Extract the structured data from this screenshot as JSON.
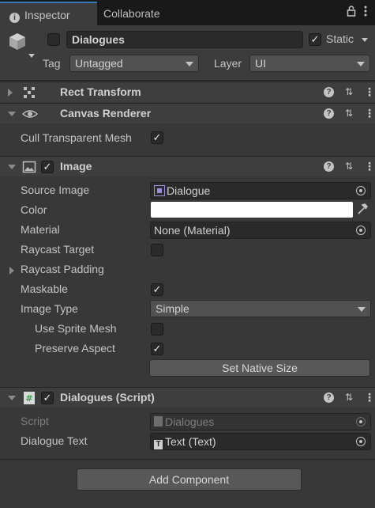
{
  "tabs": {
    "inspector": "Inspector",
    "collaborate": "Collaborate"
  },
  "header": {
    "active": true,
    "name": "Dialogues",
    "static_label": "Static",
    "static_checked": true,
    "tag_label": "Tag",
    "tag_value": "Untagged",
    "layer_label": "Layer",
    "layer_value": "UI"
  },
  "rect_transform": {
    "title": "Rect Transform"
  },
  "canvas_renderer": {
    "title": "Canvas Renderer",
    "cull_label": "Cull Transparent Mesh",
    "cull_checked": true
  },
  "image": {
    "title": "Image",
    "enabled": true,
    "source_image_label": "Source Image",
    "source_image_value": "Dialogue",
    "color_label": "Color",
    "color_value": "#ffffff",
    "material_label": "Material",
    "material_value": "None (Material)",
    "raycast_target_label": "Raycast Target",
    "raycast_target_checked": false,
    "raycast_padding_label": "Raycast Padding",
    "maskable_label": "Maskable",
    "maskable_checked": true,
    "image_type_label": "Image Type",
    "image_type_value": "Simple",
    "use_sprite_mesh_label": "Use Sprite Mesh",
    "use_sprite_mesh_checked": false,
    "preserve_aspect_label": "Preserve Aspect",
    "preserve_aspect_checked": true,
    "set_native_size_label": "Set Native Size"
  },
  "script_component": {
    "title": "Dialogues (Script)",
    "enabled": true,
    "script_label": "Script",
    "script_value": "Dialogues",
    "dialogue_text_label": "Dialogue Text",
    "dialogue_text_value": "Text (Text)"
  },
  "add_component_label": "Add Component",
  "colors": {
    "accent": "#3a79bb",
    "background": "#383838",
    "field": "#2a2a2a"
  }
}
